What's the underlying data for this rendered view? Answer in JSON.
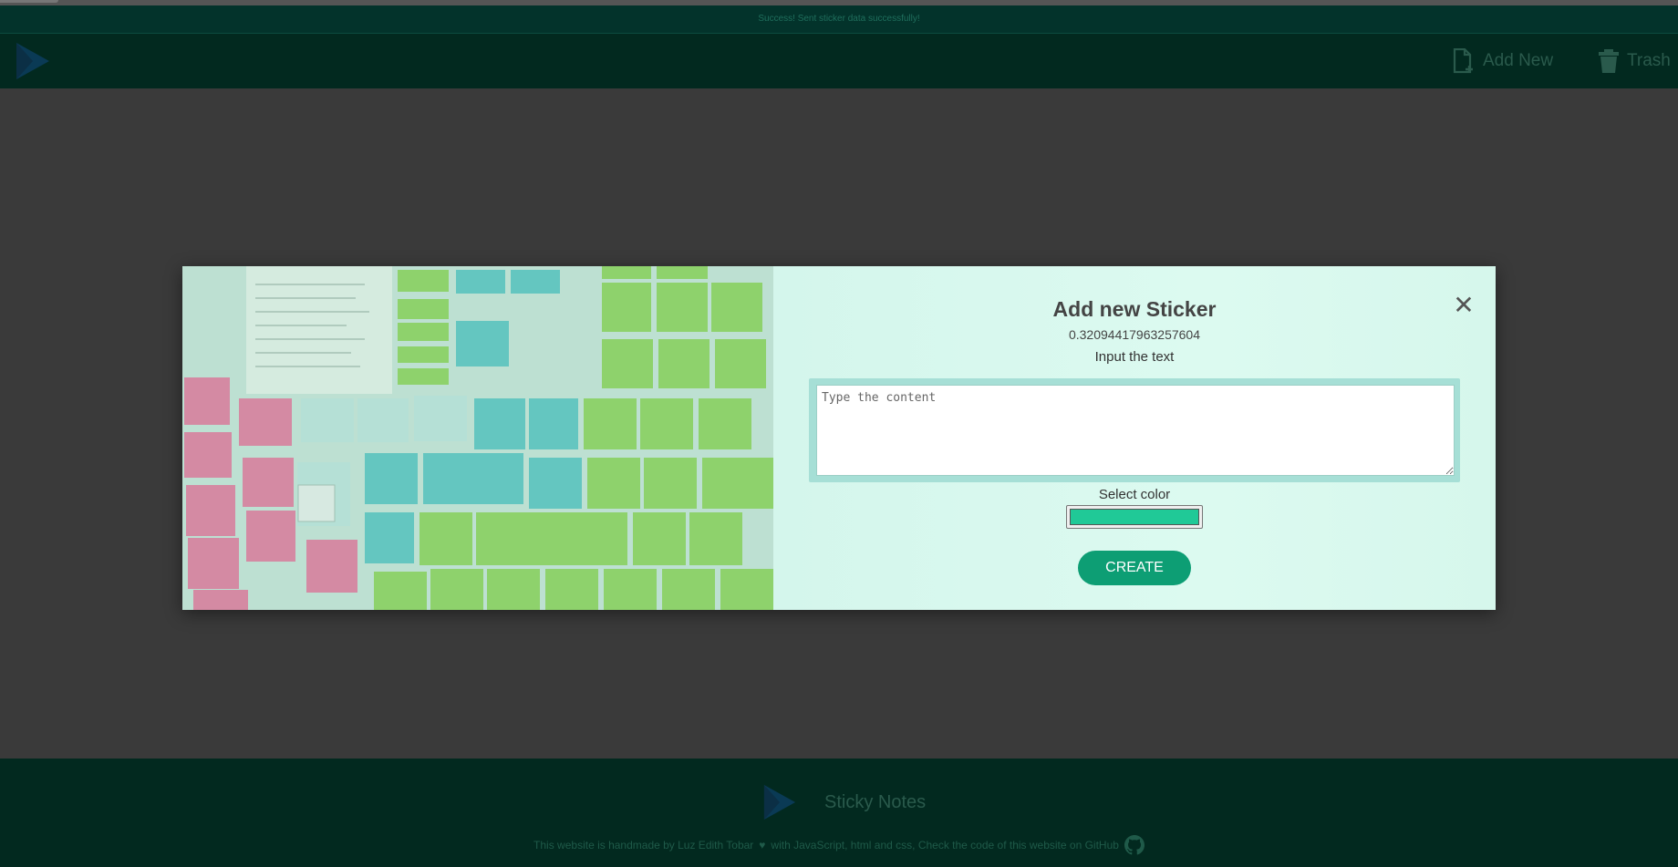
{
  "alert": {
    "message": "Success! Sent sticker data successfully!"
  },
  "navbar": {
    "add_new_label": "Add New",
    "trash_label": "Trash"
  },
  "modal": {
    "title": "Add new Sticker",
    "sticker_id": "0.32094417963257604",
    "input_label": "Input the text",
    "textarea_placeholder": "Type the content",
    "textarea_value": "",
    "color_label": "Select color",
    "selected_color": "#20c997",
    "create_label": "CREATE",
    "close_glyph": "✕"
  },
  "footer": {
    "brand": "Sticky Notes",
    "credit": "This website is handmade by Luz Edith Tobar",
    "credit_tail": "with JavaScript, html and css, Check the code of this website on GitHub",
    "heart": "♥"
  },
  "colors": {
    "brand_dark": "#02291f",
    "accent": "#0d9e74",
    "selected_color": "#20c997"
  },
  "icons": [
    "play-logo-icon",
    "add-document-icon",
    "trash-icon",
    "close-icon",
    "heart-icon",
    "github-icon"
  ]
}
